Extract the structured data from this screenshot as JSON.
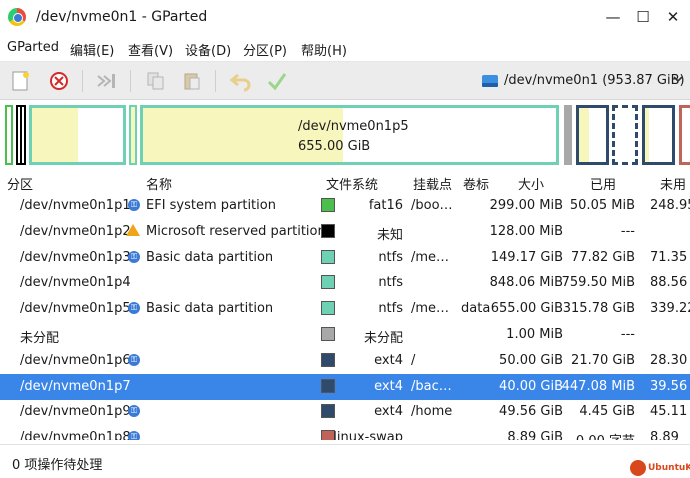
{
  "window": {
    "title": "/dev/nvme0n1 - GParted",
    "minimize_glyph": "—",
    "maximize_glyph": "☐",
    "close_glyph": "✕"
  },
  "menubar": {
    "items": [
      {
        "label": "GParted"
      },
      {
        "label": "编辑(E)"
      },
      {
        "label": "查看(V)"
      },
      {
        "label": "设备(D)"
      },
      {
        "label": "分区(P)"
      },
      {
        "label": "帮助(H)"
      }
    ]
  },
  "toolbar": {
    "buttons": [
      {
        "name": "new-partition-icon"
      },
      {
        "name": "delete-partition-icon"
      },
      {
        "name": "resize-move-icon"
      },
      {
        "name": "copy-icon"
      },
      {
        "name": "paste-icon"
      },
      {
        "name": "undo-icon"
      },
      {
        "name": "apply-icon"
      }
    ],
    "device_selector": "/dev/nvme0n1 (953.87 GiB)"
  },
  "graph": {
    "selected_label": "/dev/nvme0n1p5",
    "selected_size": "655.00 GiB"
  },
  "columns": [
    "分区",
    "名称",
    "文件系统",
    "挂载点",
    "卷标",
    "大小",
    "已用",
    "未用"
  ],
  "rows": [
    {
      "partition": "/dev/nvme0n1p1",
      "icon": "key-icon",
      "name": "EFI system partition",
      "color": "#4bbf4b",
      "filesystem": "fat16",
      "mount": "/boo…",
      "label": "",
      "size": "299.00 MiB",
      "used": "50.05 MiB",
      "unused": "248.95"
    },
    {
      "partition": "/dev/nvme0n1p2",
      "icon": "warning-icon",
      "name": "Microsoft reserved partition",
      "color": "#000000",
      "filesystem": "未知",
      "mount": "",
      "label": "",
      "size": "128.00 MiB",
      "used": "---",
      "unused": ""
    },
    {
      "partition": "/dev/nvme0n1p3",
      "icon": "key-icon",
      "name": "Basic data partition",
      "color": "#6fd1b4",
      "filesystem": "ntfs",
      "mount": "/me…",
      "label": "",
      "size": "149.17 GiB",
      "used": "77.82 GiB",
      "unused": "71.35"
    },
    {
      "partition": "/dev/nvme0n1p4",
      "icon": "",
      "name": "",
      "color": "#6fd1b4",
      "filesystem": "ntfs",
      "mount": "",
      "label": "",
      "size": "848.06 MiB",
      "used": "759.50 MiB",
      "unused": "88.56"
    },
    {
      "partition": "/dev/nvme0n1p5",
      "icon": "key-icon",
      "name": "Basic data partition",
      "color": "#6fd1b4",
      "filesystem": "ntfs",
      "mount": "/me…",
      "label": "data",
      "size": "655.00 GiB",
      "used": "315.78 GiB",
      "unused": "339.22"
    },
    {
      "partition": "未分配",
      "icon": "",
      "name": "",
      "color": "#a8a8a8",
      "filesystem": "未分配",
      "mount": "",
      "label": "",
      "size": "1.00 MiB",
      "used": "---",
      "unused": ""
    },
    {
      "partition": "/dev/nvme0n1p6",
      "icon": "key-icon",
      "name": "",
      "color": "#2f4a6b",
      "filesystem": "ext4",
      "mount": "/",
      "label": "",
      "size": "50.00 GiB",
      "used": "21.70 GiB",
      "unused": "28.30"
    },
    {
      "partition": "/dev/nvme0n1p7",
      "icon": "",
      "name": "",
      "color": "#2f4a6b",
      "filesystem": "ext4",
      "mount": "/bac…",
      "label": "",
      "size": "40.00 GiB",
      "used": "447.08 MiB",
      "unused": "39.56",
      "selected": true
    },
    {
      "partition": "/dev/nvme0n1p9",
      "icon": "key-icon",
      "name": "",
      "color": "#2f4a6b",
      "filesystem": "ext4",
      "mount": "/home",
      "label": "",
      "size": "49.56 GiB",
      "used": "4.45 GiB",
      "unused": "45.11"
    },
    {
      "partition": "/dev/nvme0n1p8",
      "icon": "key-icon",
      "name": "",
      "color": "#c0645a",
      "filesystem": "linux-swap",
      "mount": "",
      "label": "",
      "size": "8.89 GiB",
      "used": "0.00 字节",
      "unused": "8.89"
    }
  ],
  "status": {
    "pending": "0 项操作待处理"
  },
  "watermark": {
    "text": "UbuntuKylin"
  }
}
